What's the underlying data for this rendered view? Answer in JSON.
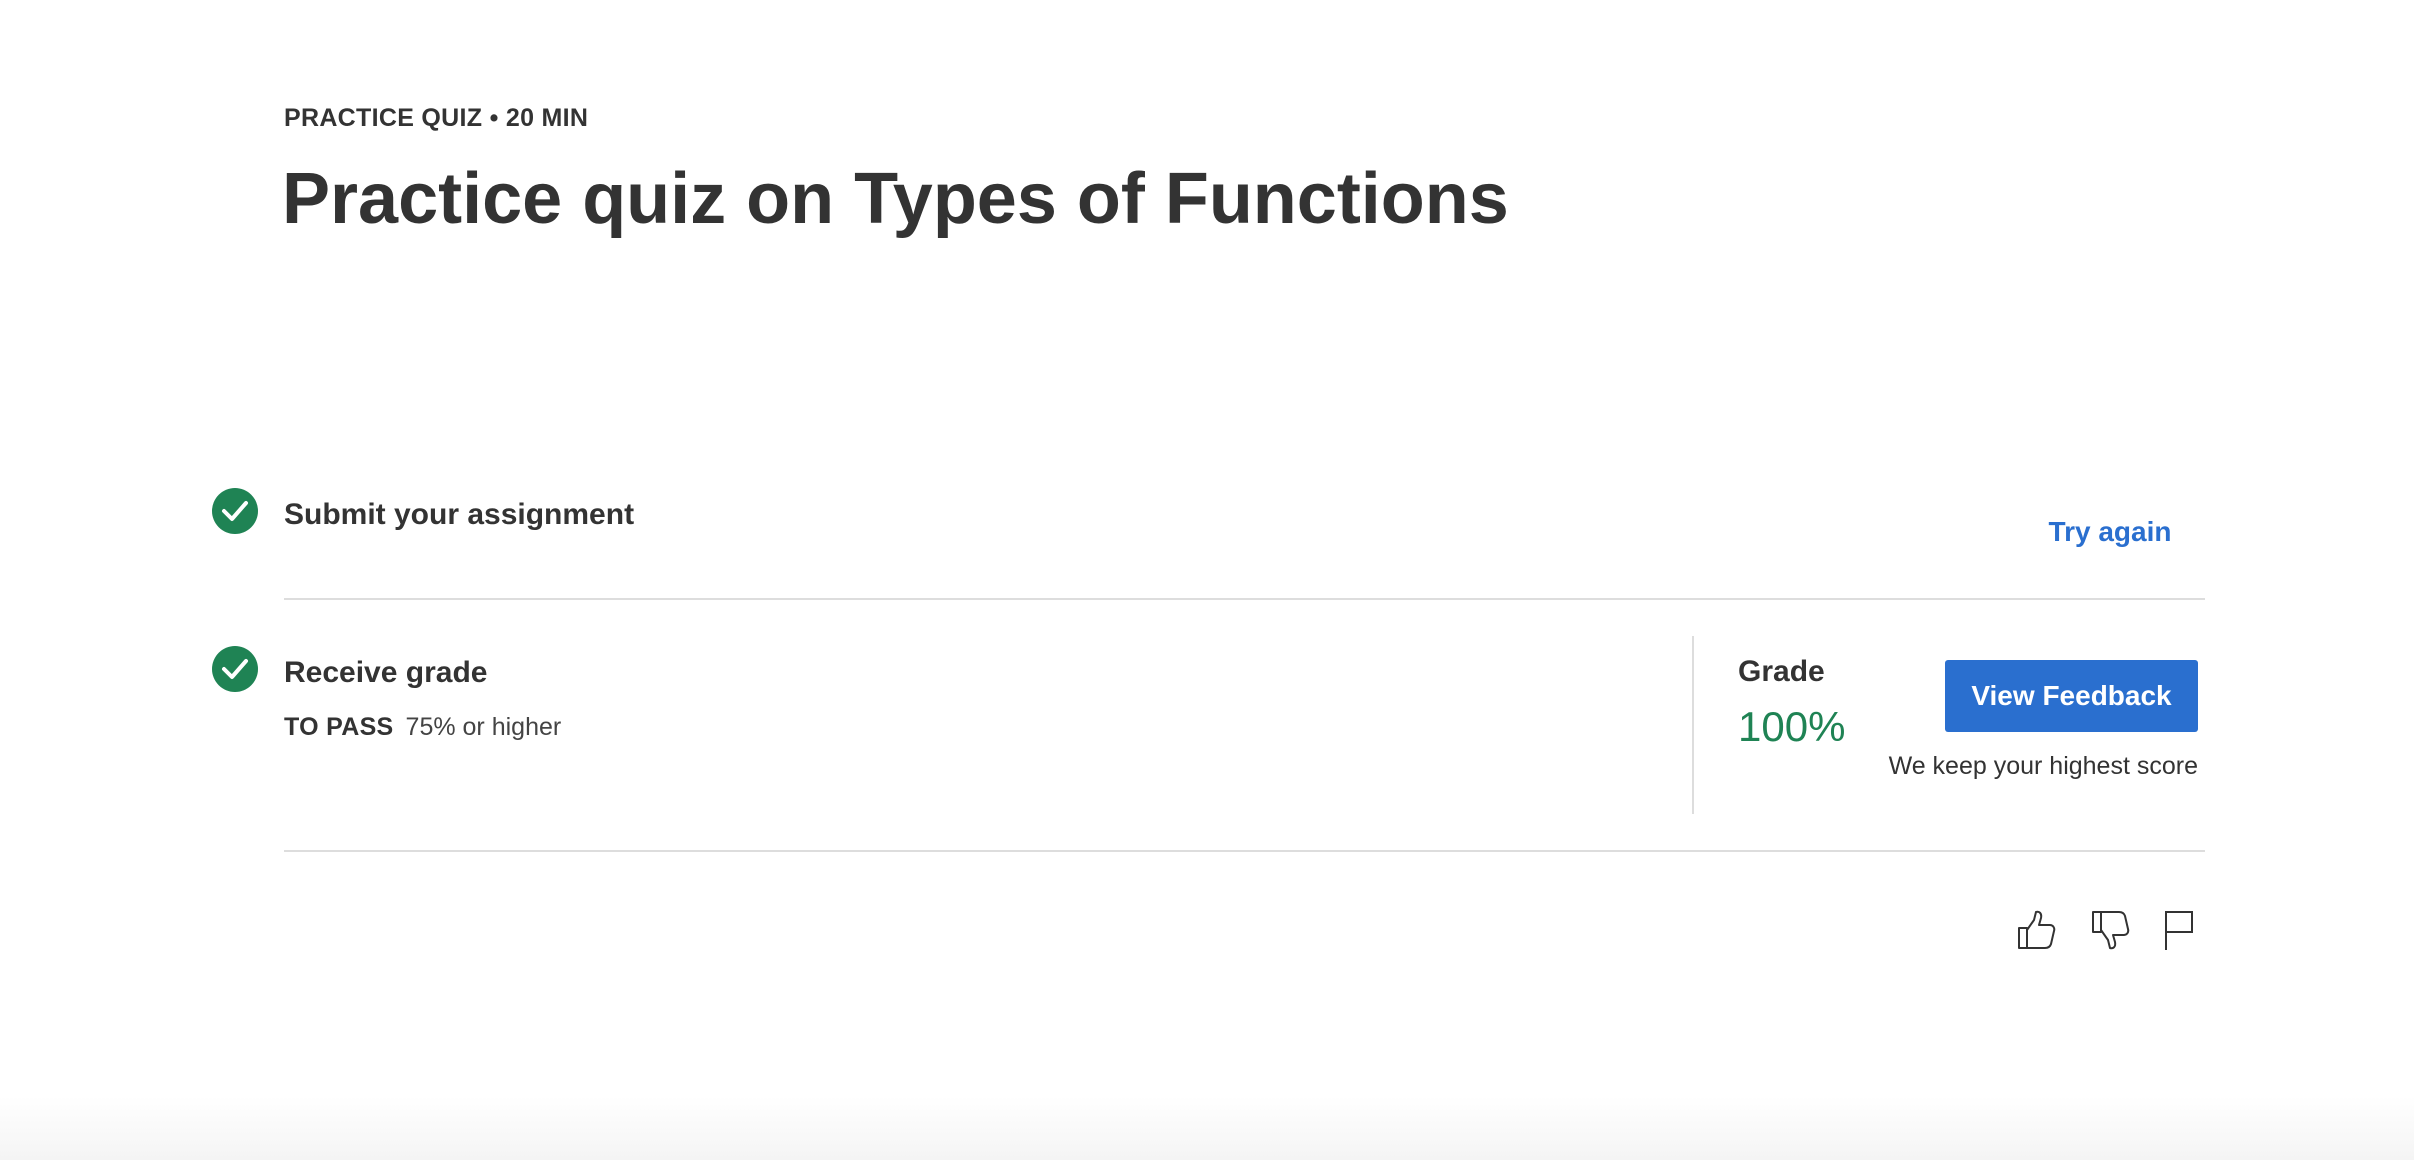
{
  "header": {
    "eyebrow": "PRACTICE QUIZ • 20 MIN",
    "title": "Practice quiz on Types of Functions"
  },
  "steps": {
    "submit": {
      "label": "Submit your assignment",
      "status": "completed",
      "action_label": "Try again"
    },
    "receive": {
      "label": "Receive grade",
      "status": "completed",
      "pass_label": "TO PASS",
      "pass_value": "75% or higher"
    }
  },
  "grade": {
    "label": "Grade",
    "value": "100%",
    "button_label": "View Feedback",
    "note": "We keep your highest score"
  },
  "feedback_icons": [
    "thumbs-up-icon",
    "thumbs-down-icon",
    "flag-icon"
  ],
  "colors": {
    "success_green": "#1f8354",
    "link_blue": "#2a6fcf",
    "text_dark": "#333333",
    "divider": "#dddddd"
  }
}
